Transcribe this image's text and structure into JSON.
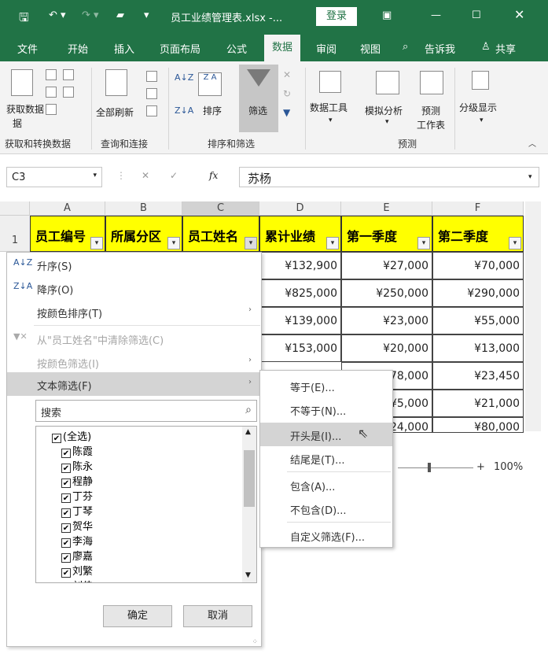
{
  "titlebar": {
    "title": "员工业绩管理表.xlsx  -...",
    "login": "登录",
    "colors": {
      "accent": "#217346"
    }
  },
  "tabs": [
    "文件",
    "开始",
    "插入",
    "页面布局",
    "公式",
    "数据",
    "审阅",
    "视图",
    "告诉我",
    "共享"
  ],
  "ribbon": {
    "get_data": "获取数据",
    "get_data2": "据",
    "refresh_all": "全部刷新",
    "sort": "排序",
    "filter": "筛选",
    "data_tools": "数据工具",
    "whatif": "模拟分析",
    "forecast": "预测",
    "forecast_sheet": "工作表",
    "outline": "分级显示",
    "groups": [
      "获取和转换数据",
      "查询和连接",
      "排序和筛选",
      "预测"
    ]
  },
  "formula_bar": {
    "namebox": "C3",
    "fx": "fx",
    "value": "苏杨"
  },
  "columns": [
    "A",
    "B",
    "C",
    "D",
    "E",
    "F"
  ],
  "row_number": "1",
  "headers": [
    "员工编号",
    "所属分区",
    "员工姓名",
    "累计业绩",
    "第一季度",
    "第二季度"
  ],
  "rows": [
    {
      "d": "¥132,900",
      "e": "¥27,000",
      "f": "¥70,000"
    },
    {
      "d": "¥825,000",
      "e": "¥250,000",
      "f": "¥290,000"
    },
    {
      "d": "¥139,000",
      "e": "¥23,000",
      "f": "¥55,000"
    },
    {
      "d": "¥153,000",
      "e": "¥20,000",
      "f": "¥13,000"
    },
    {
      "d": "",
      "e": "78,000",
      "f": "¥23,450"
    },
    {
      "d": "",
      "e": "¥5,000",
      "f": "¥21,000"
    },
    {
      "d": "",
      "e": "24,000",
      "f": "¥80,000"
    }
  ],
  "filter_menu": {
    "sort_asc": "升序(S)",
    "sort_desc": "降序(O)",
    "sort_color": "按颜色排序(T)",
    "clear_filter": "从\"员工姓名\"中清除筛选(C)",
    "filter_color": "按颜色筛选(I)",
    "text_filter": "文本筛选(F)",
    "search_placeholder": "搜索",
    "items": [
      "(全选)",
      "陈霞",
      "陈永",
      "程静",
      "丁芬",
      "丁琴",
      "贺华",
      "李海",
      "廖嘉",
      "刘繁",
      "刘佳"
    ],
    "ok": "确定",
    "cancel": "取消"
  },
  "submenu": [
    "等于(E)...",
    "不等于(N)...",
    "开头是(I)...",
    "结尾是(T)...",
    "包含(A)...",
    "不包含(D)...",
    "自定义筛选(F)..."
  ],
  "zoom": "100%"
}
